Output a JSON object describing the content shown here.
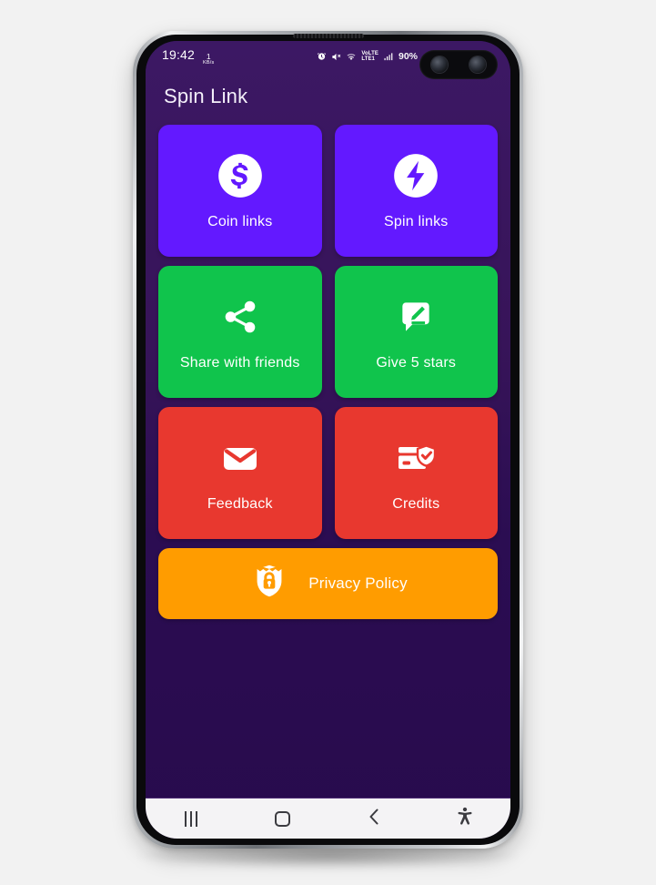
{
  "device": {
    "status_bar": {
      "clock": "19:42",
      "network_speed_value": "1",
      "network_speed_unit": "KB/s",
      "alarm_icon": "alarm-icon",
      "mute_icon": "volume-mute-icon",
      "wifi_icon": "wifi-icon",
      "volte_line1": "VoLTE",
      "volte_line2": "LTE1",
      "signal_icon": "signal-bars-icon",
      "battery": "90%"
    },
    "navigation_bar": {
      "recents_label": "recents-button",
      "home_label": "home-button",
      "back_label": "back-button",
      "accessibility_label": "accessibility-button"
    }
  },
  "app": {
    "title": "Spin Link",
    "colors": {
      "background_top": "#3c1864",
      "background_bottom": "#280b4d",
      "purple": "#6319ff",
      "green": "#10c44c",
      "red": "#e8382f",
      "orange": "#ff9c00"
    },
    "tiles": [
      {
        "label": "Coin links",
        "icon": "dollar-coin-icon",
        "color": "#6319ff"
      },
      {
        "label": "Spin links",
        "icon": "lightning-bolt-icon",
        "color": "#6319ff"
      },
      {
        "label": "Share with friends",
        "icon": "share-icon",
        "color": "#10c44c"
      },
      {
        "label": "Give 5 stars",
        "icon": "rate-review-icon",
        "color": "#10c44c"
      },
      {
        "label": "Feedback",
        "icon": "envelope-icon",
        "color": "#e8382f"
      },
      {
        "label": "Credits",
        "icon": "card-shield-icon",
        "color": "#e8382f"
      }
    ],
    "wide_button": {
      "label": "Privacy Policy",
      "icon": "shield-lock-icon",
      "color": "#ff9c00"
    }
  }
}
